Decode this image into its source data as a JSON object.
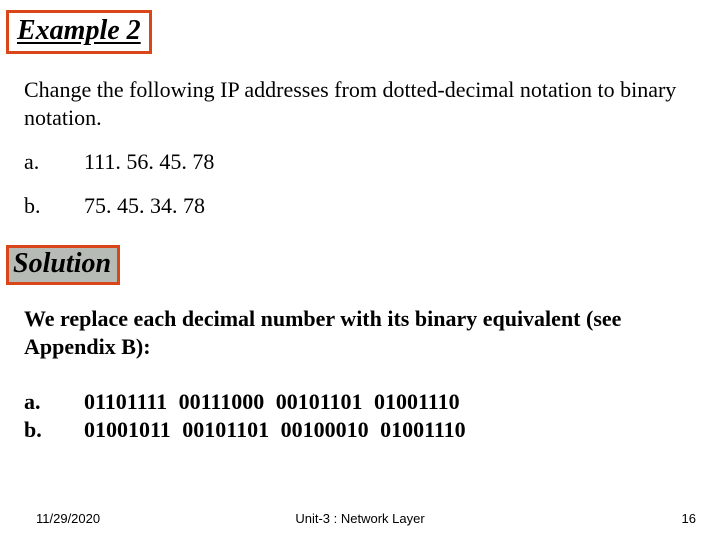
{
  "header": {
    "example_label": "Example 2"
  },
  "question": "Change the following IP addresses from dotted-decimal notation to binary notation.",
  "problems": [
    {
      "label": "a.",
      "value": "111. 56. 45. 78"
    },
    {
      "label": "b.",
      "value": "75. 45. 34. 78"
    }
  ],
  "solution": {
    "label": "Solution",
    "intro": "We replace each decimal number with its binary equivalent (see Appendix B):"
  },
  "answers": [
    {
      "label": "a.",
      "value": "01101111 00111000 00101101 01001110"
    },
    {
      "label": "b.",
      "value": "01001011 00101101 00100010 01001110"
    }
  ],
  "footer": {
    "date": "11/29/2020",
    "title": "Unit-3 : Network Layer",
    "page": "16"
  }
}
